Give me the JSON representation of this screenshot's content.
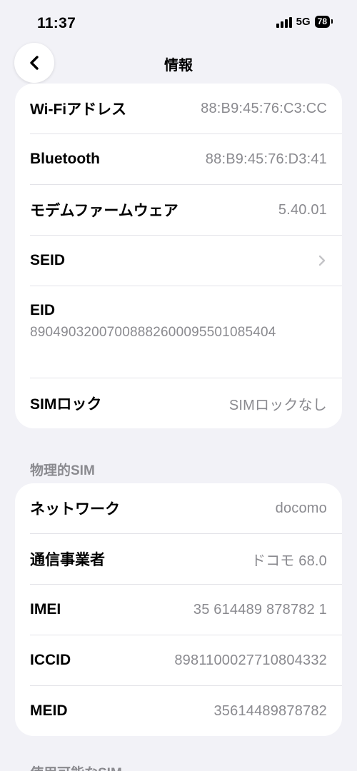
{
  "status_bar": {
    "time": "11:37",
    "network": "5G",
    "battery": "78"
  },
  "nav": {
    "title": "情報"
  },
  "card1": {
    "rows": [
      {
        "label": "Wi-Fiアドレス",
        "value": "88:B9:45:76:C3:CC"
      },
      {
        "label": "Bluetooth",
        "value": "88:B9:45:76:D3:41"
      },
      {
        "label": "モデムファームウェア",
        "value": "5.40.01"
      },
      {
        "label": "SEID",
        "value": ""
      },
      {
        "label": "EID",
        "value": "89049032007008882600095501085404"
      },
      {
        "label": "SIMロック",
        "value": "SIMロックなし"
      }
    ]
  },
  "physical_sim": {
    "header": "物理的SIM",
    "rows": [
      {
        "label": "ネットワーク",
        "value": "docomo"
      },
      {
        "label": "通信事業者",
        "value": "ドコモ 68.0"
      },
      {
        "label": "IMEI",
        "value": "35 614489 878782 1"
      },
      {
        "label": "ICCID",
        "value": "8981100027710804332"
      },
      {
        "label": "MEID",
        "value": "35614489878782"
      }
    ]
  },
  "next_section": {
    "header": "使用可能なSIM"
  },
  "colors": {
    "background": "#f2f2f7",
    "card": "#ffffff",
    "secondary_text": "#8a8a8f",
    "separator": "#e3e3e8"
  },
  "icons": {
    "back": "chevron-left-icon",
    "disclosure": "chevron-right-icon"
  }
}
